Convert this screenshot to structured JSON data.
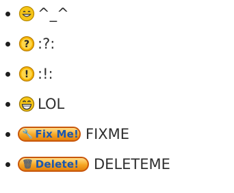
{
  "items": [
    {
      "icon": "grinning-face-icon",
      "text": "^_^"
    },
    {
      "icon": "question-icon",
      "symbol": "?",
      "text": ":?:"
    },
    {
      "icon": "exclamation-icon",
      "symbol": "!",
      "text": ":!:"
    },
    {
      "icon": "lol-face-icon",
      "text": "LOL"
    },
    {
      "icon": "fixme-badge-icon",
      "badge": "Fix Me!",
      "text": "FIXME"
    },
    {
      "icon": "delete-badge-icon",
      "badge": "Delete!",
      "text": "DELETEME"
    }
  ],
  "colors": {
    "smiley_yellow": "#f5c518",
    "badge_orange": "#f6a623",
    "badge_text": "#1a56b0"
  }
}
